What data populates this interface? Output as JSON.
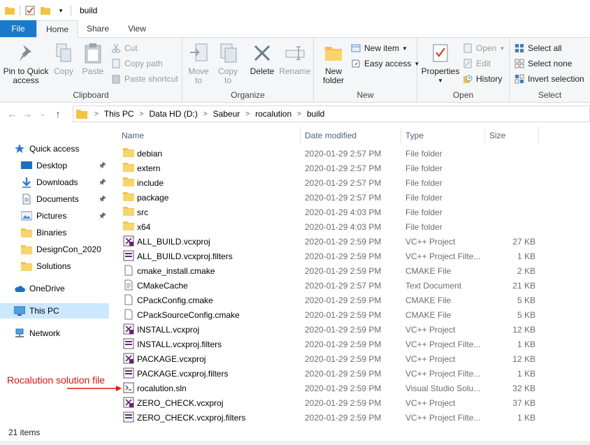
{
  "window": {
    "title": "build"
  },
  "tabs": [
    "File",
    "Home",
    "Share",
    "View"
  ],
  "ribbon": {
    "clipboard": {
      "label": "Clipboard",
      "pin": "Pin to Quick\naccess",
      "copy": "Copy",
      "paste": "Paste",
      "cut": "Cut",
      "copy_path": "Copy path",
      "paste_shortcut": "Paste shortcut"
    },
    "organize": {
      "label": "Organize",
      "move_to": "Move\nto",
      "copy_to": "Copy\nto",
      "delete": "Delete",
      "rename": "Rename"
    },
    "new": {
      "label": "New",
      "new_folder": "New\nfolder",
      "new_item": "New item",
      "easy_access": "Easy access"
    },
    "open": {
      "label": "Open",
      "properties": "Properties",
      "open": "Open",
      "edit": "Edit",
      "history": "History"
    },
    "select": {
      "label": "Select",
      "select_all": "Select all",
      "select_none": "Select none",
      "invert": "Invert selection"
    }
  },
  "address": {
    "crumbs": [
      "This PC",
      "Data HD (D:)",
      "Sabeur",
      "rocalution",
      "build"
    ]
  },
  "nav": [
    {
      "label": "Quick access",
      "icon": "star-icon",
      "indent": false,
      "pinned": false
    },
    {
      "label": "Desktop",
      "icon": "desktop-icon",
      "indent": true,
      "pinned": true
    },
    {
      "label": "Downloads",
      "icon": "download-icon",
      "indent": true,
      "pinned": true
    },
    {
      "label": "Documents",
      "icon": "documents-icon",
      "indent": true,
      "pinned": true
    },
    {
      "label": "Pictures",
      "icon": "pictures-icon",
      "indent": true,
      "pinned": true
    },
    {
      "label": "Binaries",
      "icon": "folder-icon",
      "indent": true,
      "pinned": false
    },
    {
      "label": "DesignCon_2020",
      "icon": "folder-icon",
      "indent": true,
      "pinned": false
    },
    {
      "label": "Solutions",
      "icon": "folder-icon",
      "indent": true,
      "pinned": false
    },
    {
      "label": "OneDrive",
      "icon": "cloud-icon",
      "indent": false,
      "pinned": false
    },
    {
      "label": "This PC",
      "icon": "pc-icon",
      "indent": false,
      "pinned": false,
      "selected": true
    },
    {
      "label": "Network",
      "icon": "network-icon",
      "indent": false,
      "pinned": false
    }
  ],
  "columns": {
    "name": "Name",
    "date": "Date modified",
    "type": "Type",
    "size": "Size"
  },
  "files": [
    {
      "name": "debian",
      "date": "2020-01-29 2:57 PM",
      "type": "File folder",
      "size": "",
      "icon": "folder-icon"
    },
    {
      "name": "extern",
      "date": "2020-01-29 2:57 PM",
      "type": "File folder",
      "size": "",
      "icon": "folder-icon"
    },
    {
      "name": "include",
      "date": "2020-01-29 2:57 PM",
      "type": "File folder",
      "size": "",
      "icon": "folder-icon"
    },
    {
      "name": "package",
      "date": "2020-01-29 2:57 PM",
      "type": "File folder",
      "size": "",
      "icon": "folder-icon"
    },
    {
      "name": "src",
      "date": "2020-01-29 4:03 PM",
      "type": "File folder",
      "size": "",
      "icon": "folder-icon"
    },
    {
      "name": "x64",
      "date": "2020-01-29 4:03 PM",
      "type": "File folder",
      "size": "",
      "icon": "folder-icon"
    },
    {
      "name": "ALL_BUILD.vcxproj",
      "date": "2020-01-29 2:59 PM",
      "type": "VC++ Project",
      "size": "27 KB",
      "icon": "vcxproj-icon"
    },
    {
      "name": "ALL_BUILD.vcxproj.filters",
      "date": "2020-01-29 2:59 PM",
      "type": "VC++ Project Filte...",
      "size": "1 KB",
      "icon": "filters-icon"
    },
    {
      "name": "cmake_install.cmake",
      "date": "2020-01-29 2:59 PM",
      "type": "CMAKE File",
      "size": "2 KB",
      "icon": "file-icon"
    },
    {
      "name": "CMakeCache",
      "date": "2020-01-29 2:57 PM",
      "type": "Text Document",
      "size": "21 KB",
      "icon": "text-file-icon"
    },
    {
      "name": "CPackConfig.cmake",
      "date": "2020-01-29 2:59 PM",
      "type": "CMAKE File",
      "size": "5 KB",
      "icon": "file-icon"
    },
    {
      "name": "CPackSourceConfig.cmake",
      "date": "2020-01-29 2:59 PM",
      "type": "CMAKE File",
      "size": "5 KB",
      "icon": "file-icon"
    },
    {
      "name": "INSTALL.vcxproj",
      "date": "2020-01-29 2:59 PM",
      "type": "VC++ Project",
      "size": "12 KB",
      "icon": "vcxproj-icon"
    },
    {
      "name": "INSTALL.vcxproj.filters",
      "date": "2020-01-29 2:59 PM",
      "type": "VC++ Project Filte...",
      "size": "1 KB",
      "icon": "filters-icon"
    },
    {
      "name": "PACKAGE.vcxproj",
      "date": "2020-01-29 2:59 PM",
      "type": "VC++ Project",
      "size": "12 KB",
      "icon": "vcxproj-icon"
    },
    {
      "name": "PACKAGE.vcxproj.filters",
      "date": "2020-01-29 2:59 PM",
      "type": "VC++ Project Filte...",
      "size": "1 KB",
      "icon": "filters-icon"
    },
    {
      "name": "rocalution.sln",
      "date": "2020-01-29 2:59 PM",
      "type": "Visual Studio Solu...",
      "size": "32 KB",
      "icon": "sln-icon"
    },
    {
      "name": "ZERO_CHECK.vcxproj",
      "date": "2020-01-29 2:59 PM",
      "type": "VC++ Project",
      "size": "37 KB",
      "icon": "vcxproj-icon"
    },
    {
      "name": "ZERO_CHECK.vcxproj.filters",
      "date": "2020-01-29 2:59 PM",
      "type": "VC++ Project Filte...",
      "size": "1 KB",
      "icon": "filters-icon"
    }
  ],
  "status": {
    "count": "21 items"
  },
  "annotation": {
    "text": "Rocalution solution file",
    "color": "#e8120c"
  },
  "colors": {
    "accent": "#1979ca",
    "selection": "#cce8ff",
    "folder": "#f5c242"
  }
}
